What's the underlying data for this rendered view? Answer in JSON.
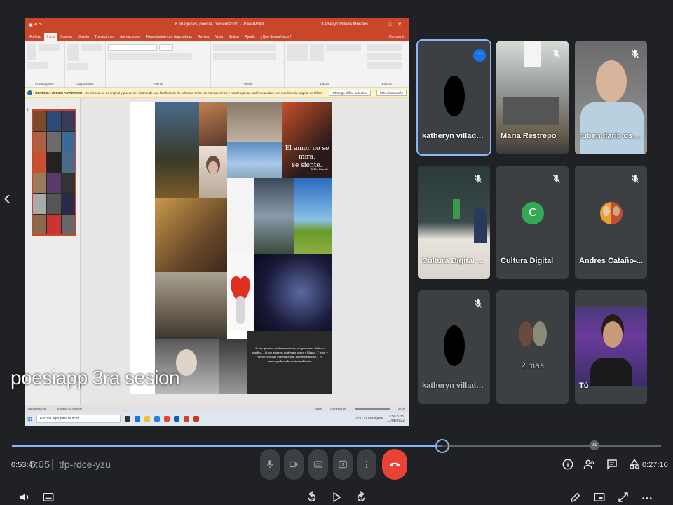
{
  "powerpoint": {
    "window_title": "6 imágenes, poesía, presentación - PowerPoint",
    "account": "Katheryn Villada Morales",
    "tabs": [
      "Archivo",
      "Inicio",
      "Insertar",
      "Diseño",
      "Transiciones",
      "Animaciones",
      "Presentación con diapositivas",
      "Revisar",
      "Vista",
      "Grabar",
      "Ayuda",
      "¿Qué desea hacer?"
    ],
    "share_label": "Compartir",
    "ribbon_groups": [
      "Portapapeles",
      "Diapositivas",
      "Fuente",
      "Párrafo",
      "Dibujo",
      "Edición"
    ],
    "notice": {
      "title": "OBTENGA OFFICE AUTÉNTICO",
      "text": "Su licencia no es original y puede ser víctima de una falsificación de software. Evite las interrupciones y mantenga sus archivos a salvo con una licencia original de Office hoy mismo.",
      "primary_button": "Obtenga Office auténtico",
      "secondary_button": "Más información"
    },
    "slide_number": "1",
    "slide": {
      "quote1_line1": "El amor no se mira,",
      "quote1_line2": "se siente.",
      "quote1_author": "Pablo Neruda",
      "quote2": "Si me quieres, quiéreme entera, no por zonas de luz o sombra... Si me quieres, quiéreme negra y blanca. Y gris, y verde, y rubia, quiéreme día, quiéreme noche... ¡Y madrugada en la ventana abierta!"
    },
    "statusbar": {
      "slide_info": "Diapositiva 1 de 1",
      "language": "Español (Colombia)",
      "notes": "Notas",
      "comments": "Comentarios",
      "zoom": "49 %"
    },
    "taskbar": {
      "search_placeholder": "Escribe aquí para buscar",
      "weather": "22°C Lluvia ligera",
      "time": "3:58 p. m.",
      "date": "17/08/2022"
    }
  },
  "caption": "poesiapp 3ra sesion",
  "participants": [
    {
      "name": "katheryn villada m...",
      "muted": false,
      "more": true,
      "active": true,
      "avatar": "black"
    },
    {
      "name": "Maria Restrepo",
      "muted": true,
      "active": false,
      "avatar": "video"
    },
    {
      "name": "ruben dario ospi...",
      "muted": true,
      "active": false,
      "avatar": "video"
    },
    {
      "name": "Cultura Digital S...",
      "muted": true,
      "active": false,
      "avatar": "video"
    },
    {
      "name": "Cultura Digital",
      "muted": true,
      "active": false,
      "avatar": "letter",
      "letter": "C"
    },
    {
      "name": "Andres Cataño-...",
      "muted": true,
      "active": false,
      "avatar": "photo"
    },
    {
      "name": "katheryn villada m...",
      "muted": true,
      "active": false,
      "avatar": "black"
    },
    {
      "name": "2 más",
      "muted": false,
      "active": false,
      "avatar": "group"
    },
    {
      "name": "Tú",
      "muted": false,
      "active": false,
      "avatar": "video"
    }
  ],
  "player": {
    "elapsed": "0:53:47",
    "elapsed_overlap": "5:05",
    "remaining": "0:27:10",
    "meeting_code": "tfp-rdce-yzu",
    "progress": 0.663,
    "skip_back_seconds": "10",
    "skip_forward_seconds": "30",
    "participant_count": "11"
  },
  "colors": {
    "ppt_brand": "#c9462b",
    "meet_bg": "#202124",
    "tile_bg": "#3c4043",
    "accent_blue": "#8ab4f8",
    "hangup_red": "#ea4335",
    "avatar_green": "#34a853"
  },
  "icons": {
    "mic": "mic-icon",
    "camera": "camera-icon",
    "captions": "captions-icon",
    "present": "present-icon",
    "more": "more-vert-icon",
    "hangup": "hangup-icon",
    "info": "info-icon",
    "people": "people-icon",
    "chat": "chat-icon",
    "activities": "activities-icon",
    "volume": "volume-icon",
    "subtitles": "subtitles-icon",
    "rewind": "rewind-10-icon",
    "play": "play-icon",
    "forward": "forward-30-icon",
    "edit": "edit-icon",
    "pip": "picture-in-picture-icon",
    "fullscreen": "fullscreen-icon",
    "overflow": "more-horiz-icon",
    "mic_off": "mic-off-icon",
    "chevron_left": "chevron-left-icon"
  }
}
